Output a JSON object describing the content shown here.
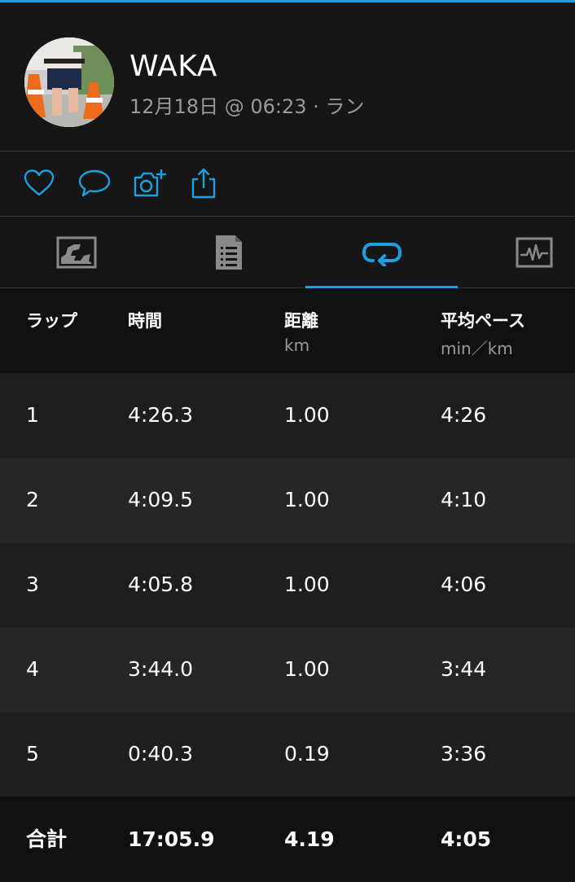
{
  "accent": "#1a9fe0",
  "activity": {
    "user_name": "WAKA",
    "subtitle": "12月18日 @ 06:23 · ラン"
  },
  "actions": [
    {
      "icon": "heart-icon"
    },
    {
      "icon": "comment-icon"
    },
    {
      "icon": "camera-add-icon"
    },
    {
      "icon": "share-icon"
    }
  ],
  "tabs": [
    {
      "icon": "map-icon",
      "selected": false
    },
    {
      "icon": "summary-icon",
      "selected": false
    },
    {
      "icon": "laps-icon",
      "selected": true
    },
    {
      "icon": "graph-icon",
      "selected": false
    }
  ],
  "laps_table": {
    "headers": {
      "lap": "ラップ",
      "time": "時間",
      "distance": "距離",
      "distance_unit": "km",
      "pace": "平均ペース",
      "pace_unit": "min／km"
    },
    "rows": [
      {
        "lap": "1",
        "time": "4:26.3",
        "distance": "1.00",
        "pace": "4:26"
      },
      {
        "lap": "2",
        "time": "4:09.5",
        "distance": "1.00",
        "pace": "4:10"
      },
      {
        "lap": "3",
        "time": "4:05.8",
        "distance": "1.00",
        "pace": "4:06"
      },
      {
        "lap": "4",
        "time": "3:44.0",
        "distance": "1.00",
        "pace": "3:44"
      },
      {
        "lap": "5",
        "time": "0:40.3",
        "distance": "0.19",
        "pace": "3:36"
      }
    ],
    "total": {
      "label": "合計",
      "time": "17:05.9",
      "distance": "4.19",
      "pace": "4:05"
    }
  }
}
